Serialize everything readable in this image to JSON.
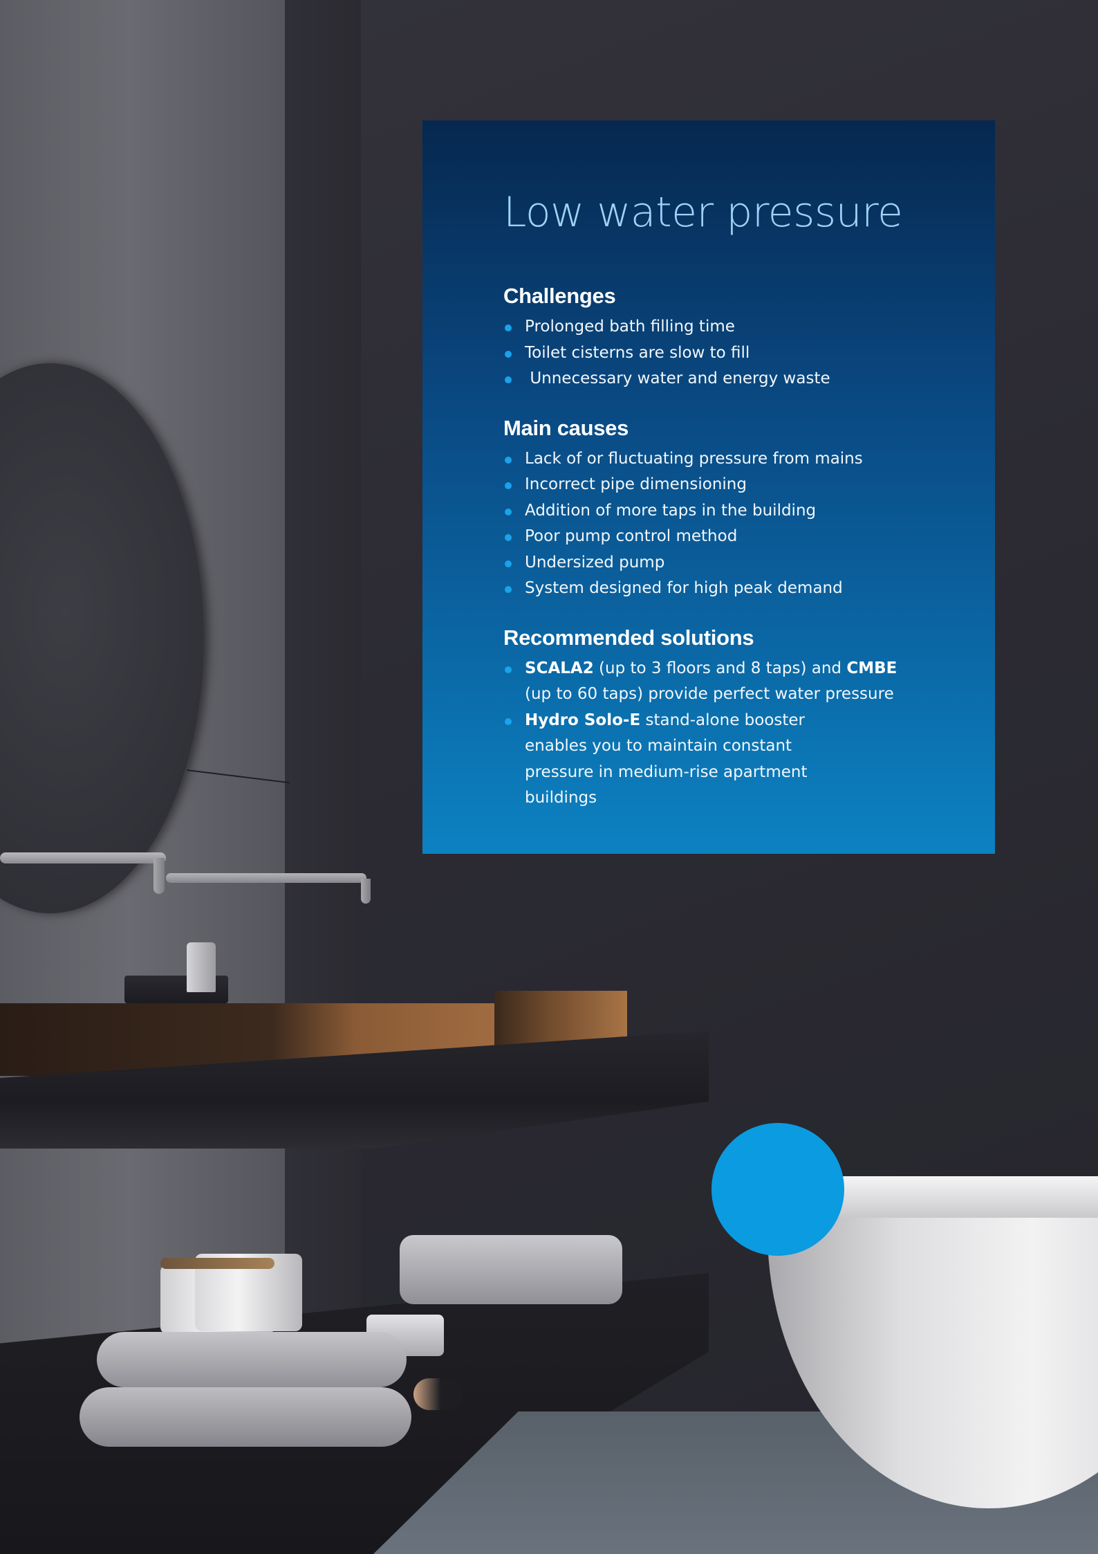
{
  "panel": {
    "title": "Low water pressure",
    "challenges": {
      "heading": "Challenges",
      "items": [
        "Prolonged bath filling time",
        "Toilet cisterns are slow to fill",
        "Unnecessary water and energy waste"
      ]
    },
    "causes": {
      "heading": "Main causes",
      "items": [
        "Lack of or fluctuating pressure from mains",
        "Incorrect pipe dimensioning",
        "Addition of more taps in the building",
        "Poor pump control method",
        "Undersized pump",
        "System designed for high peak demand"
      ]
    },
    "solutions": {
      "heading": "Recommended solutions",
      "items": [
        {
          "product_a": "SCALA2",
          "text_a": " (up to 3 floors and 8 taps) and ",
          "product_b": "CMBE",
          "text_b": " (up to 60 taps) provide perfect water pressure"
        },
        {
          "product": "Hydro Solo-E",
          "text": " stand-alone booster enables you to maintain constant pressure in medium-rise apartment buildings"
        }
      ]
    }
  },
  "colors": {
    "title_color": "#9fd3f6",
    "bullet_color": "#1aa3ea",
    "accent_circle": "#0a9be0",
    "panel_top": "#06284f",
    "panel_bottom": "#0c82c2"
  }
}
